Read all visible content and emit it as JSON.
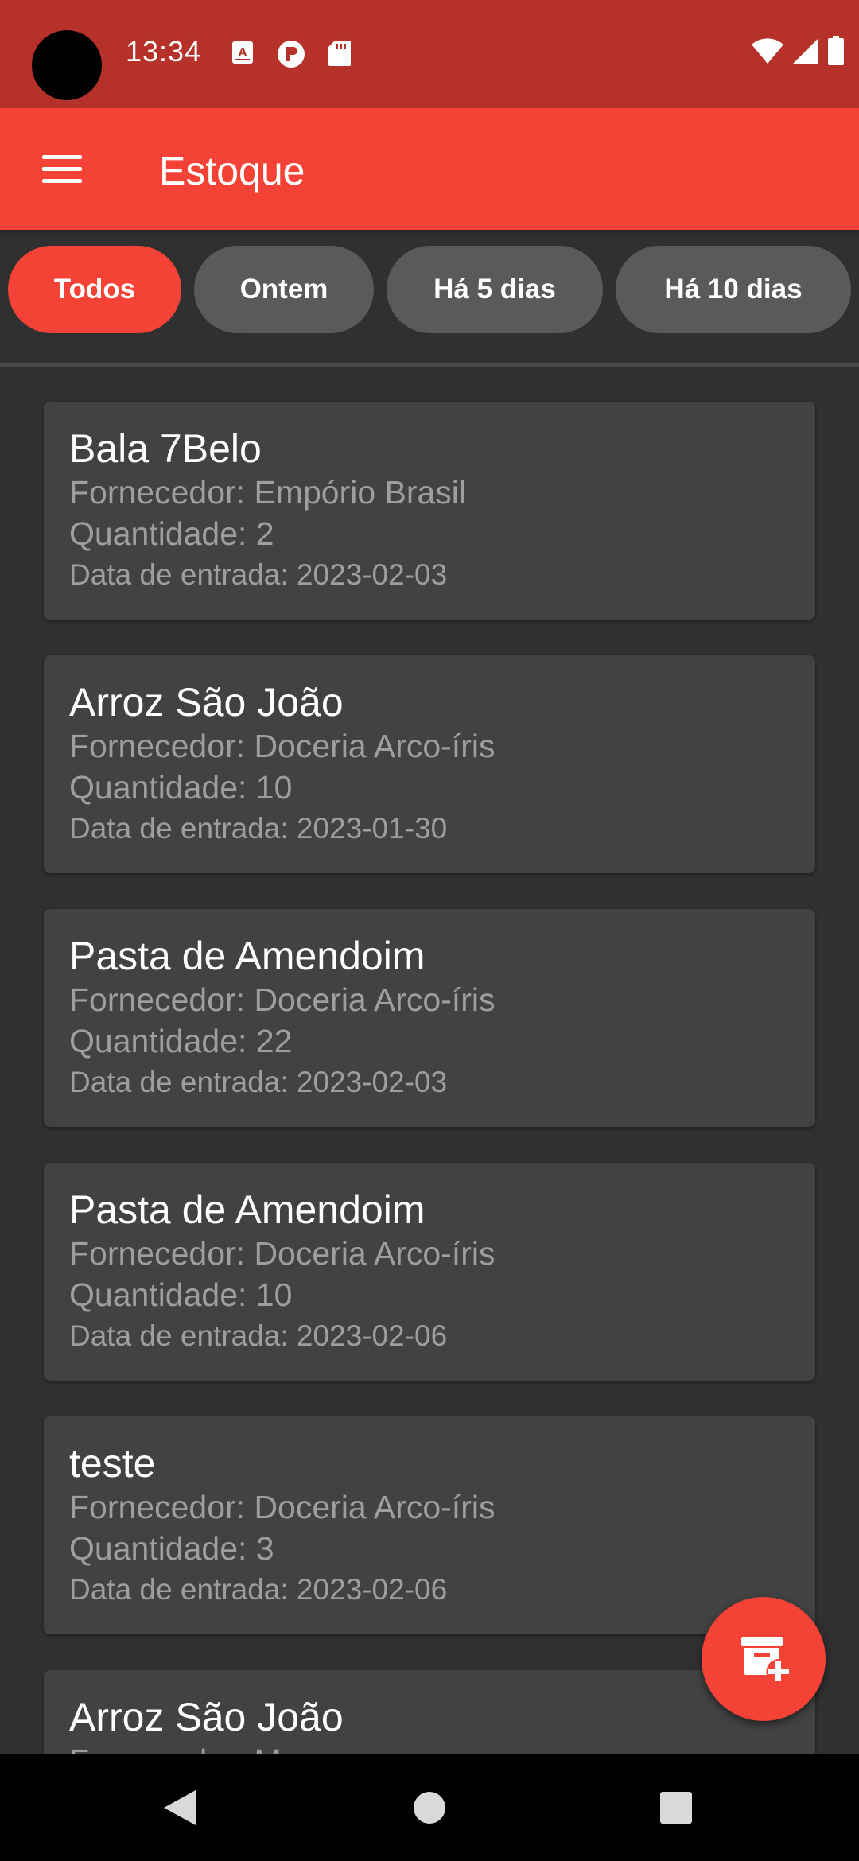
{
  "status_bar": {
    "time": "13:34",
    "notification_icons": [
      "a-box-icon",
      "p-circle-icon",
      "sd-card-icon"
    ],
    "system_icons": [
      "wifi-icon",
      "signal-icon",
      "battery-icon"
    ]
  },
  "app_bar": {
    "title": "Estoque",
    "menu_icon": "hamburger-menu-icon"
  },
  "filters": {
    "chips": [
      {
        "label": "Todos",
        "active": true
      },
      {
        "label": "Ontem",
        "active": false
      },
      {
        "label": "Há 5 dias",
        "active": false
      },
      {
        "label": "Há 10 dias",
        "active": false
      }
    ]
  },
  "items": [
    {
      "name": "Bala 7Belo",
      "supplier": "Fornecedor: Empório Brasil",
      "quantity": "Quantidade: 2",
      "date": "Data de entrada: 2023-02-03"
    },
    {
      "name": "Arroz São João",
      "supplier": "Fornecedor: Doceria Arco-íris",
      "quantity": "Quantidade: 10",
      "date": "Data de entrada: 2023-01-30"
    },
    {
      "name": "Pasta de Amendoim",
      "supplier": "Fornecedor: Doceria Arco-íris",
      "quantity": "Quantidade: 22",
      "date": "Data de entrada: 2023-02-03"
    },
    {
      "name": "Pasta de Amendoim",
      "supplier": "Fornecedor: Doceria Arco-íris",
      "quantity": "Quantidade: 10",
      "date": "Data de entrada: 2023-02-06"
    },
    {
      "name": "teste",
      "supplier": "Fornecedor: Doceria Arco-íris",
      "quantity": "Quantidade: 3",
      "date": "Data de entrada: 2023-02-06"
    },
    {
      "name": "Arroz São João",
      "supplier": "Fornecedor: M",
      "quantity": "",
      "date": ""
    }
  ],
  "fab": {
    "icon": "add-to-archive-icon"
  },
  "nav_bar": {
    "icons": [
      "back-triangle-icon",
      "home-circle-icon",
      "recents-square-icon"
    ]
  },
  "colors": {
    "primary": "#F44336",
    "status_bar": "#B5312A",
    "background": "#303030",
    "card": "#424242",
    "chip_inactive": "#5A5A5A",
    "secondary_text": "#9E9E9E"
  }
}
